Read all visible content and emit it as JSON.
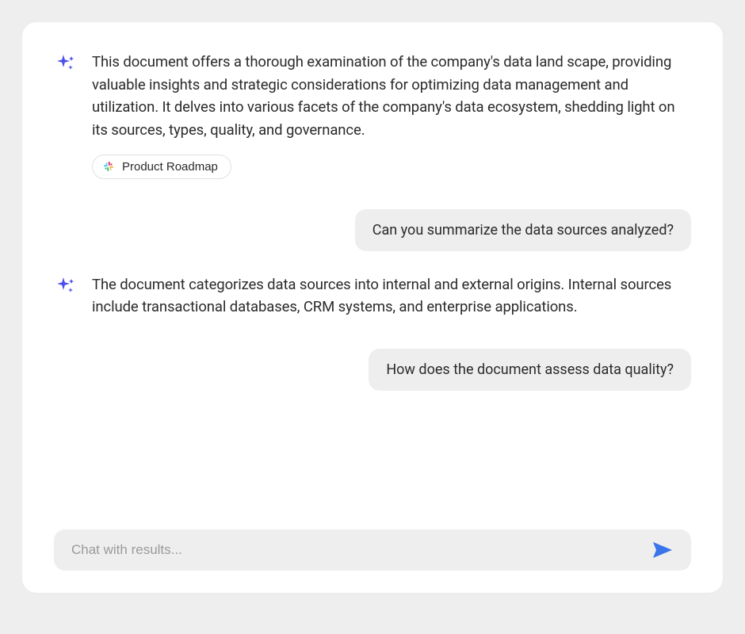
{
  "messages": {
    "ai_0": {
      "text": "This document offers a thorough examination of the company's data land scape, providing valuable insights and strategic considerations for optimizing data management and utilization. It delves into various facets of the company's data ecosystem, shedding light on its sources, types, quality, and governance.",
      "source_chip_label": "Product Roadmap"
    },
    "user_0": {
      "text": "Can you summarize the data sources analyzed?"
    },
    "ai_1": {
      "text": "The document categorizes data sources into internal and external origins. Internal sources include transactional databases, CRM systems, and enterprise applications."
    },
    "user_1": {
      "text": "How does the document assess data quality?"
    }
  },
  "input": {
    "placeholder": "Chat with results..."
  },
  "colors": {
    "accent": "#4a4eea",
    "send": "#3a74ea"
  }
}
